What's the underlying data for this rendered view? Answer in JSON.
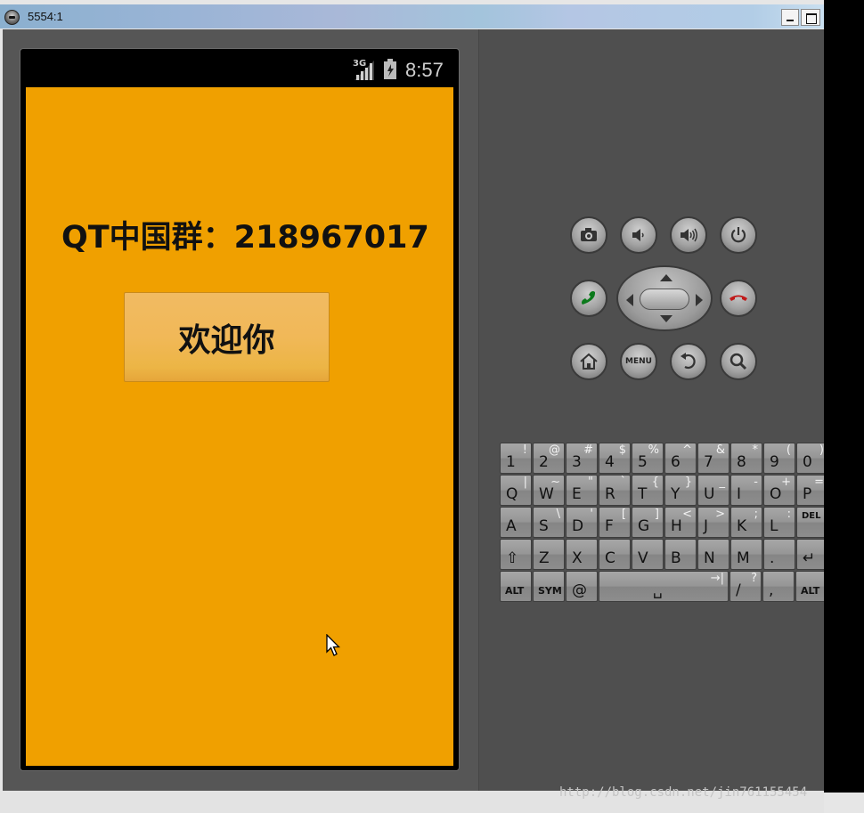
{
  "window": {
    "title": "5554:1"
  },
  "statusbar": {
    "network": "3G",
    "time": "8:57"
  },
  "app": {
    "label": "QT中国群：218967017",
    "button": "欢迎你"
  },
  "controls": {
    "menu_label": "MENU"
  },
  "keyboard": {
    "rows": [
      [
        {
          "m": "1",
          "s": "!"
        },
        {
          "m": "2",
          "s": "@"
        },
        {
          "m": "3",
          "s": "#"
        },
        {
          "m": "4",
          "s": "$"
        },
        {
          "m": "5",
          "s": "%"
        },
        {
          "m": "6",
          "s": "^"
        },
        {
          "m": "7",
          "s": "&"
        },
        {
          "m": "8",
          "s": "*"
        },
        {
          "m": "9",
          "s": "("
        },
        {
          "m": "0",
          "s": ")"
        }
      ],
      [
        {
          "m": "Q",
          "s": "|"
        },
        {
          "m": "W",
          "s": "~"
        },
        {
          "m": "E",
          "s": "\""
        },
        {
          "m": "R",
          "s": "`"
        },
        {
          "m": "T",
          "s": "{"
        },
        {
          "m": "Y",
          "s": "}"
        },
        {
          "m": "U",
          "s": "_"
        },
        {
          "m": "I",
          "s": "-"
        },
        {
          "m": "O",
          "s": "+"
        },
        {
          "m": "P",
          "s": "="
        }
      ],
      [
        {
          "m": "A",
          "s": ""
        },
        {
          "m": "S",
          "s": "\\"
        },
        {
          "m": "D",
          "s": "'"
        },
        {
          "m": "F",
          "s": "["
        },
        {
          "m": "G",
          "s": "]"
        },
        {
          "m": "H",
          "s": "<"
        },
        {
          "m": "J",
          "s": ">"
        },
        {
          "m": "K",
          "s": ";"
        },
        {
          "m": "L",
          "s": ":"
        },
        {
          "m": "DEL",
          "s": ""
        }
      ],
      [
        {
          "m": "⇧",
          "s": ""
        },
        {
          "m": "Z",
          "s": ""
        },
        {
          "m": "X",
          "s": ""
        },
        {
          "m": "C",
          "s": ""
        },
        {
          "m": "V",
          "s": ""
        },
        {
          "m": "B",
          "s": ""
        },
        {
          "m": "N",
          "s": ""
        },
        {
          "m": "M",
          "s": ""
        },
        {
          "m": ".",
          "s": ""
        },
        {
          "m": "↵",
          "s": ""
        }
      ],
      [
        {
          "m": "ALT",
          "s": ""
        },
        {
          "m": "SYM",
          "s": ""
        },
        {
          "m": "@",
          "s": ""
        },
        {
          "m": "␣",
          "s": "→|"
        },
        {
          "m": "/",
          "s": "?"
        },
        {
          "m": ",",
          "s": ""
        },
        {
          "m": "ALT",
          "s": ""
        }
      ]
    ]
  },
  "watermark": "http://blog.csdn.net/jin761155454"
}
